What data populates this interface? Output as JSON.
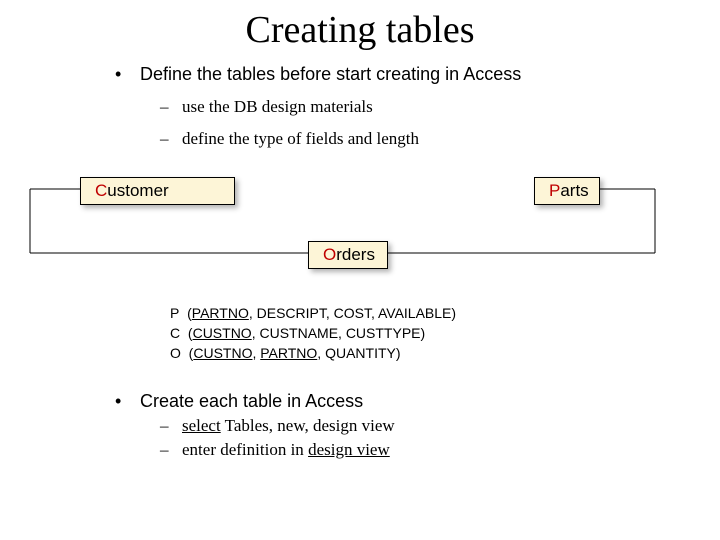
{
  "title": "Creating tables",
  "bullets": {
    "main1": "Define the tables before start creating in Access",
    "sub1": "use the DB design materials",
    "sub2": "define the type of fields and length",
    "main2": "Create each table in Access",
    "sub3_prefix": "select",
    "sub3_rest": " Tables, new, design view",
    "sub4_prefix": "enter definition in ",
    "sub4_link": "design view"
  },
  "entities": {
    "customer": "ustomer",
    "customer_accent": "C",
    "parts": "arts",
    "parts_accent": "P",
    "orders": "rders",
    "orders_accent": "O"
  },
  "schema": {
    "p_label": "P",
    "p_open": "(",
    "p_key": "PARTNO",
    "p_rest": ", DESCRIPT, COST, AVAILABLE)",
    "c_label": "C",
    "c_open": "(",
    "c_key": "CUSTNO",
    "c_rest": ", CUSTNAME, CUSTTYPE)",
    "o_label": "O",
    "o_open": "(",
    "o_key1": "CUSTNO",
    "o_sep": ", ",
    "o_key2": "PARTNO",
    "o_rest": ", QUANTITY)"
  }
}
